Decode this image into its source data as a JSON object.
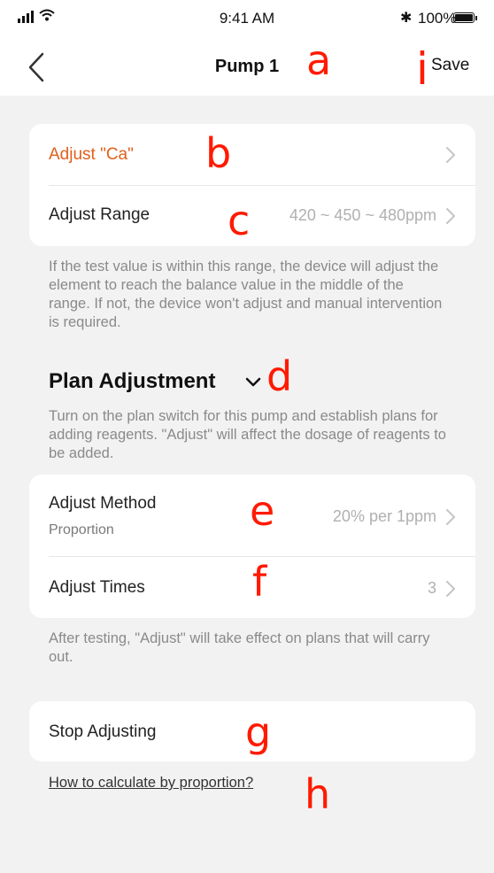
{
  "status_bar": {
    "time": "9:41 AM",
    "battery": "100%",
    "bluetooth_symbol": "✱"
  },
  "nav": {
    "title": "Pump 1",
    "save_label": "Save",
    "back_icon": "chevron-left-icon"
  },
  "adjust_card": {
    "element_label": "Adjust \"Ca\"",
    "range_label": "Adjust Range",
    "range_value": "420 ~ 450 ~ 480ppm"
  },
  "range_note": "If the test value is within this range, the device will adjust the element to reach the balance value in the middle of the range. If not, the device won't adjust and manual intervention is required.",
  "plan_section": {
    "title": "Plan Adjustment",
    "description": "Turn on the plan switch for this pump and establish plans for adding reagents. \"Adjust\" will affect the dosage of reagents to be added."
  },
  "plan_card": {
    "method_label": "Adjust Method",
    "method_sub": "Proportion",
    "method_value": "20% per 1ppm",
    "times_label": "Adjust Times",
    "times_value": "3"
  },
  "plan_note": "After testing, \"Adjust\" will take effect on plans that will carry out.",
  "stop_card": {
    "label": "Stop Adjusting"
  },
  "help_link": "How to calculate by proportion?",
  "annotations": {
    "a": "a",
    "b": "b",
    "c": "c",
    "d": "d",
    "e": "e",
    "f": "f",
    "g": "g",
    "h": "h",
    "i": "i"
  },
  "colors": {
    "accent": "#e0601c",
    "annotation": "#ff1a00",
    "background": "#f2f2f2",
    "value_text": "#b0b0b0",
    "note_text": "#8a8a8a"
  }
}
